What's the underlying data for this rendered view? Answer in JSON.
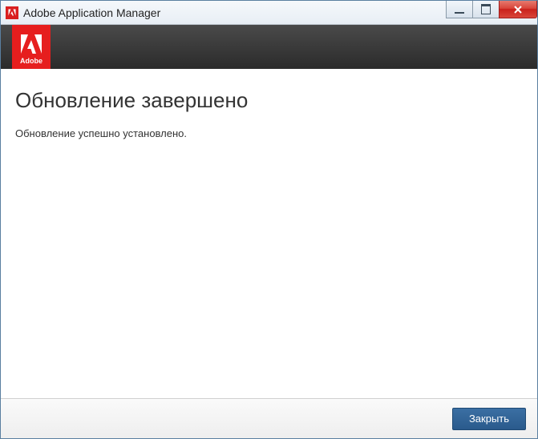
{
  "window": {
    "title": "Adobe Application Manager"
  },
  "brand": {
    "name": "Adobe"
  },
  "content": {
    "heading": "Обновление завершено",
    "message": "Обновление успешно установлено."
  },
  "footer": {
    "close_label": "Закрыть"
  }
}
